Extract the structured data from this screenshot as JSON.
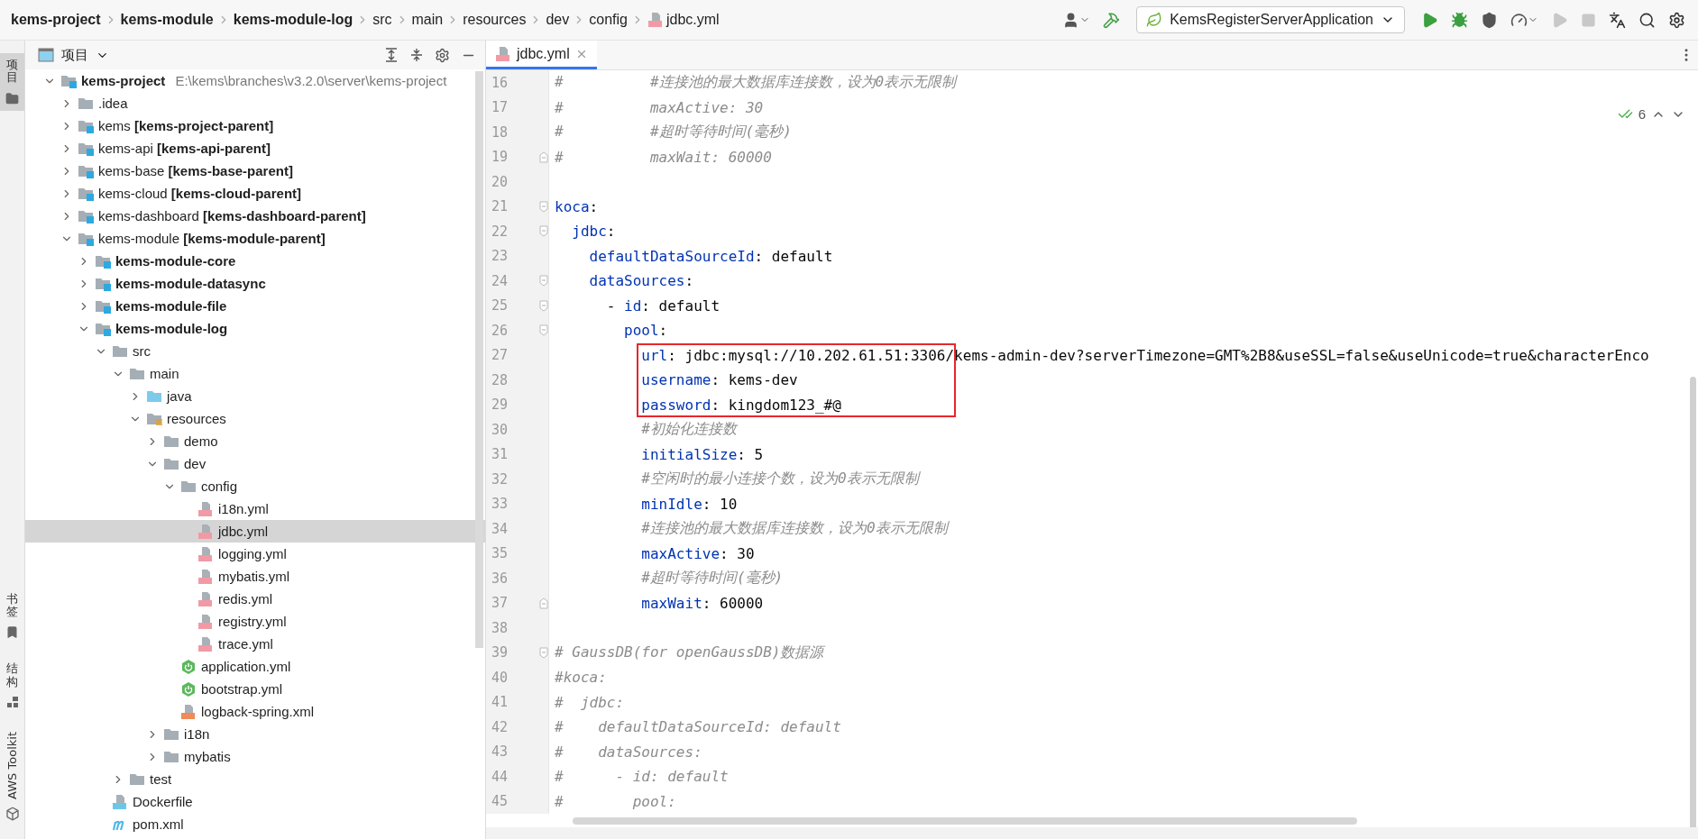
{
  "breadcrumbs": [
    {
      "label": "kems-project",
      "kind": "module"
    },
    {
      "label": "kems-module",
      "kind": "module"
    },
    {
      "label": "kems-module-log",
      "kind": "module"
    },
    {
      "label": "src",
      "kind": "folder"
    },
    {
      "label": "main",
      "kind": "folder"
    },
    {
      "label": "resources",
      "kind": "folder"
    },
    {
      "label": "dev",
      "kind": "folder"
    },
    {
      "label": "config",
      "kind": "folder"
    },
    {
      "label": "jdbc.yml",
      "kind": "file"
    }
  ],
  "toolbar": {
    "run_configuration": "KemsRegisterServerApplication",
    "buttons": [
      {
        "kind": "user",
        "disabled": false
      },
      {
        "kind": "build",
        "disabled": false
      },
      {
        "kind": "config"
      },
      {
        "kind": "run",
        "disabled": false
      },
      {
        "kind": "debug",
        "disabled": false
      },
      {
        "kind": "coverage",
        "disabled": false
      },
      {
        "kind": "profile",
        "disabled": false
      },
      {
        "kind": "rerun",
        "disabled": true
      },
      {
        "kind": "stop",
        "disabled": true
      },
      {
        "kind": "translate",
        "disabled": false
      },
      {
        "kind": "search",
        "disabled": false
      },
      {
        "kind": "settings",
        "disabled": false
      }
    ]
  },
  "tool_stripe": [
    {
      "label": "项目",
      "kind": "project",
      "selected": true
    },
    {
      "label": "书签",
      "kind": "bookmarks",
      "selected": false
    },
    {
      "label": "结构",
      "kind": "structure",
      "selected": false
    },
    {
      "label": "AWS Toolkit",
      "kind": "aws",
      "selected": false
    }
  ],
  "project_panel": {
    "title": "项目",
    "tree": [
      {
        "label": "kems-project",
        "path": "E:\\kems\\branches\\v3.2.0\\server\\kems-project",
        "kind": "module",
        "bold": true,
        "expanded": true,
        "selected": false,
        "children": [
          {
            "label": ".idea",
            "kind": "folder",
            "bold": false,
            "expanded": false,
            "selected": false
          },
          {
            "label": "kems **[kems-project-parent]**",
            "kind": "module",
            "bold": false,
            "expanded": false,
            "selected": false
          },
          {
            "label": "kems-api **[kems-api-parent]**",
            "kind": "module",
            "bold": false,
            "expanded": false,
            "selected": false
          },
          {
            "label": "kems-base **[kems-base-parent]**",
            "kind": "module",
            "bold": false,
            "expanded": false,
            "selected": false
          },
          {
            "label": "kems-cloud **[kems-cloud-parent]**",
            "kind": "module",
            "bold": false,
            "expanded": false,
            "selected": false
          },
          {
            "label": "kems-dashboard **[kems-dashboard-parent]**",
            "kind": "module",
            "bold": false,
            "expanded": false,
            "selected": false
          },
          {
            "label": "kems-module **[kems-module-parent]**",
            "kind": "module",
            "bold": false,
            "expanded": true,
            "selected": false,
            "children": [
              {
                "label": "kems-module-core",
                "kind": "module",
                "bold": true,
                "expanded": false,
                "selected": false
              },
              {
                "label": "kems-module-datasync",
                "kind": "module",
                "bold": true,
                "expanded": false,
                "selected": false
              },
              {
                "label": "kems-module-file",
                "kind": "module",
                "bold": true,
                "expanded": false,
                "selected": false
              },
              {
                "label": "kems-module-log",
                "kind": "module",
                "bold": true,
                "expanded": true,
                "selected": false,
                "children": [
                  {
                    "label": "src",
                    "kind": "folder",
                    "bold": false,
                    "expanded": true,
                    "selected": false,
                    "children": [
                      {
                        "label": "main",
                        "kind": "folder",
                        "bold": false,
                        "expanded": true,
                        "selected": false,
                        "children": [
                          {
                            "label": "java",
                            "kind": "source",
                            "bold": false,
                            "expanded": false,
                            "selected": false
                          },
                          {
                            "label": "resources",
                            "kind": "resources",
                            "bold": false,
                            "expanded": true,
                            "selected": false,
                            "children": [
                              {
                                "label": "demo",
                                "kind": "folder",
                                "bold": false,
                                "expanded": false,
                                "selected": false
                              },
                              {
                                "label": "dev",
                                "kind": "folder",
                                "bold": false,
                                "expanded": true,
                                "selected": false,
                                "children": [
                                  {
                                    "label": "config",
                                    "kind": "folder",
                                    "bold": false,
                                    "expanded": true,
                                    "selected": false,
                                    "children": [
                                      {
                                        "label": "i18n.yml",
                                        "kind": "yml",
                                        "bold": false,
                                        "selected": false
                                      },
                                      {
                                        "label": "jdbc.yml",
                                        "kind": "yml",
                                        "bold": false,
                                        "selected": true
                                      },
                                      {
                                        "label": "logging.yml",
                                        "kind": "yml",
                                        "bold": false,
                                        "selected": false
                                      },
                                      {
                                        "label": "mybatis.yml",
                                        "kind": "yml",
                                        "bold": false,
                                        "selected": false
                                      },
                                      {
                                        "label": "redis.yml",
                                        "kind": "yml",
                                        "bold": false,
                                        "selected": false
                                      },
                                      {
                                        "label": "registry.yml",
                                        "kind": "yml",
                                        "bold": false,
                                        "selected": false
                                      },
                                      {
                                        "label": "trace.yml",
                                        "kind": "yml",
                                        "bold": false,
                                        "selected": false
                                      }
                                    ]
                                  },
                                  {
                                    "label": "application.yml",
                                    "kind": "spring",
                                    "bold": false,
                                    "selected": false
                                  },
                                  {
                                    "label": "bootstrap.yml",
                                    "kind": "spring",
                                    "bold": false,
                                    "selected": false
                                  },
                                  {
                                    "label": "logback-spring.xml",
                                    "kind": "xml",
                                    "bold": false,
                                    "selected": false
                                  }
                                ]
                              },
                              {
                                "label": "i18n",
                                "kind": "folder",
                                "bold": false,
                                "expanded": false,
                                "selected": false
                              },
                              {
                                "label": "mybatis",
                                "kind": "folder",
                                "bold": false,
                                "expanded": false,
                                "selected": false
                              }
                            ]
                          }
                        ]
                      },
                      {
                        "label": "test",
                        "kind": "folder",
                        "bold": false,
                        "expanded": false,
                        "selected": false
                      }
                    ]
                  },
                  {
                    "label": "Dockerfile",
                    "kind": "docker",
                    "bold": false,
                    "selected": false
                  },
                  {
                    "label": "pom.xml",
                    "kind": "maven",
                    "bold": false,
                    "selected": false
                  }
                ]
              }
            ]
          }
        ]
      }
    ]
  },
  "editor": {
    "tabs": [
      {
        "label": "jdbc.yml",
        "selected": true
      }
    ],
    "inspections": "6",
    "lines": [
      {
        "number": "16",
        "segments": [
          {
            "kind": "comment",
            "text": "#          #连接池的最大数据库连接数，设为0表示无限制"
          }
        ]
      },
      {
        "number": "17",
        "segments": [
          {
            "kind": "comment",
            "text": "#          maxActive: 30"
          }
        ]
      },
      {
        "number": "18",
        "segments": [
          {
            "kind": "comment",
            "text": "#          #超时等待时间(毫秒)"
          }
        ]
      },
      {
        "number": "19",
        "fold_end": true,
        "segments": [
          {
            "kind": "comment",
            "text": "#          maxWait: 60000"
          }
        ]
      },
      {
        "number": "20"
      },
      {
        "number": "21",
        "fold_start": true,
        "segments": [
          {
            "kind": "key",
            "text": "koca"
          },
          {
            "kind": "plain",
            "text": ":"
          }
        ]
      },
      {
        "number": "22",
        "fold_start": true,
        "segments": [
          {
            "kind": "key",
            "text": "  jdbc"
          },
          {
            "kind": "plain",
            "text": ":"
          }
        ]
      },
      {
        "number": "23",
        "segments": [
          {
            "kind": "key",
            "text": "    defaultDataSourceId"
          },
          {
            "kind": "plain",
            "text": ": default"
          }
        ]
      },
      {
        "number": "24",
        "fold_start": true,
        "segments": [
          {
            "kind": "key",
            "text": "    dataSources"
          },
          {
            "kind": "plain",
            "text": ":"
          }
        ]
      },
      {
        "number": "25",
        "fold_start": true,
        "segments": [
          {
            "kind": "plain",
            "text": "      - "
          },
          {
            "kind": "key",
            "text": "id"
          },
          {
            "kind": "plain",
            "text": ": default"
          }
        ]
      },
      {
        "number": "26",
        "fold_start": true,
        "segments": [
          {
            "kind": "key",
            "text": "        pool"
          },
          {
            "kind": "plain",
            "text": ":"
          }
        ]
      },
      {
        "number": "27",
        "boxed": true,
        "segments": [
          {
            "kind": "key",
            "text": "          url"
          },
          {
            "kind": "plain",
            "text": ": jdbc:mysql://10.202.61.51:3306/kems-admin-dev?serverTimezone=GMT%2B8&useSSL=false&useUnicode=true&characterEnco"
          }
        ]
      },
      {
        "number": "28",
        "boxed": true,
        "segments": [
          {
            "kind": "key",
            "text": "          username"
          },
          {
            "kind": "plain",
            "text": ": kems-dev"
          }
        ]
      },
      {
        "number": "29",
        "boxed": true,
        "segments": [
          {
            "kind": "key",
            "text": "          password"
          },
          {
            "kind": "plain",
            "text": ": kingdom123_#@"
          }
        ]
      },
      {
        "number": "30",
        "segments": [
          {
            "kind": "comment",
            "text": "          #初始化连接数"
          }
        ]
      },
      {
        "number": "31",
        "segments": [
          {
            "kind": "key",
            "text": "          initialSize"
          },
          {
            "kind": "plain",
            "text": ": 5"
          }
        ]
      },
      {
        "number": "32",
        "segments": [
          {
            "kind": "comment",
            "text": "          #空闲时的最小连接个数，设为0表示无限制"
          }
        ]
      },
      {
        "number": "33",
        "segments": [
          {
            "kind": "key",
            "text": "          minIdle"
          },
          {
            "kind": "plain",
            "text": ": 10"
          }
        ]
      },
      {
        "number": "34",
        "segments": [
          {
            "kind": "comment",
            "text": "          #连接池的最大数据库连接数，设为0表示无限制"
          }
        ]
      },
      {
        "number": "35",
        "segments": [
          {
            "kind": "key",
            "text": "          maxActive"
          },
          {
            "kind": "plain",
            "text": ": 30"
          }
        ]
      },
      {
        "number": "36",
        "segments": [
          {
            "kind": "comment",
            "text": "          #超时等待时间(毫秒)"
          }
        ]
      },
      {
        "number": "37",
        "fold_end": true,
        "segments": [
          {
            "kind": "key",
            "text": "          maxWait"
          },
          {
            "kind": "plain",
            "text": ": 60000"
          }
        ]
      },
      {
        "number": "38"
      },
      {
        "number": "39",
        "fold_start": true,
        "segments": [
          {
            "kind": "comment",
            "text": "# GaussDB(for openGaussDB)数据源"
          }
        ]
      },
      {
        "number": "40",
        "segments": [
          {
            "kind": "comment",
            "text": "#koca:"
          }
        ]
      },
      {
        "number": "41",
        "segments": [
          {
            "kind": "comment",
            "text": "#  jdbc:"
          }
        ]
      },
      {
        "number": "42",
        "segments": [
          {
            "kind": "comment",
            "text": "#    defaultDataSourceId: default"
          }
        ]
      },
      {
        "number": "43",
        "segments": [
          {
            "kind": "comment",
            "text": "#    dataSources:"
          }
        ]
      },
      {
        "number": "44",
        "segments": [
          {
            "kind": "comment",
            "text": "#      - id: default"
          }
        ]
      },
      {
        "number": "45",
        "segments": [
          {
            "kind": "comment",
            "text": "#        pool:"
          }
        ]
      }
    ]
  }
}
